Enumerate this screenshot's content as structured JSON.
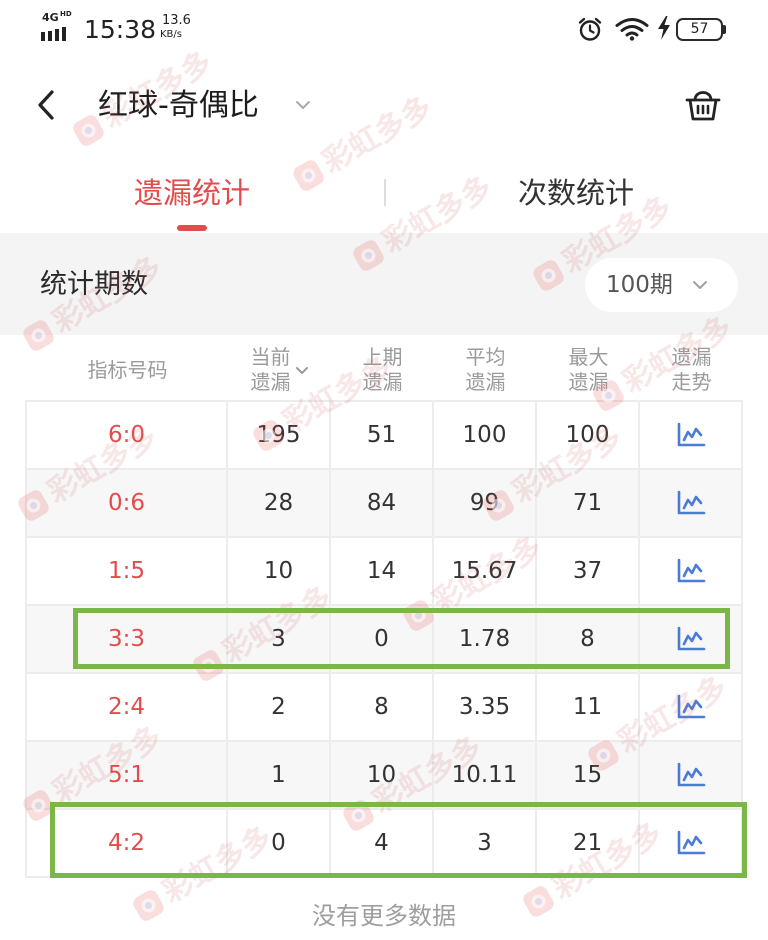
{
  "status_bar": {
    "network": "4G",
    "network_badge": "HD",
    "time": "15:38",
    "speed": "13.6",
    "speed_unit": "KB/s",
    "battery_level": "57",
    "icons": [
      "signal-icon",
      "alarm-icon",
      "wifi-icon",
      "charging-icon",
      "battery-icon"
    ]
  },
  "header": {
    "back_icon": "chevron-left-icon",
    "title": "红球-奇偶比",
    "title_menu_icon": "chevron-down-icon",
    "action_icon": "basket-icon"
  },
  "tabs": [
    {
      "label": "遗漏统计",
      "active": true
    },
    {
      "label": "次数统计",
      "active": false
    }
  ],
  "period_filter": {
    "label": "统计期数",
    "value": "100期",
    "icon": "chevron-down-icon"
  },
  "table": {
    "columns": [
      {
        "lines": [
          "指标号码"
        ]
      },
      {
        "lines": [
          "当前",
          "遗漏"
        ],
        "sort_icon": "chevron-down-icon"
      },
      {
        "lines": [
          "上期",
          "遗漏"
        ]
      },
      {
        "lines": [
          "平均",
          "遗漏"
        ]
      },
      {
        "lines": [
          "最大",
          "遗漏"
        ]
      },
      {
        "lines": [
          "遗漏",
          "走势"
        ]
      }
    ],
    "rows": [
      {
        "label": "6:0",
        "current": "195",
        "previous": "51",
        "average": "100",
        "max": "100",
        "trend_icon": "line-chart-icon",
        "highlighted": false
      },
      {
        "label": "0:6",
        "current": "28",
        "previous": "84",
        "average": "99",
        "max": "71",
        "trend_icon": "line-chart-icon",
        "highlighted": false
      },
      {
        "label": "1:5",
        "current": "10",
        "previous": "14",
        "average": "15.67",
        "max": "37",
        "trend_icon": "line-chart-icon",
        "highlighted": false
      },
      {
        "label": "3:3",
        "current": "3",
        "previous": "0",
        "average": "1.78",
        "max": "8",
        "trend_icon": "line-chart-icon",
        "highlighted": true
      },
      {
        "label": "2:4",
        "current": "2",
        "previous": "8",
        "average": "3.35",
        "max": "11",
        "trend_icon": "line-chart-icon",
        "highlighted": false
      },
      {
        "label": "5:1",
        "current": "1",
        "previous": "10",
        "average": "10.11",
        "max": "15",
        "trend_icon": "line-chart-icon",
        "highlighted": false
      },
      {
        "label": "4:2",
        "current": "0",
        "previous": "4",
        "average": "3",
        "max": "21",
        "trend_icon": "line-chart-icon",
        "highlighted": true
      }
    ]
  },
  "footer_text": "没有更多数据",
  "watermark": {
    "text": "彩虹多多",
    "icon": "brand-logo-icon"
  },
  "colors": {
    "accent": "#e24c4c",
    "highlight_box": "#7ab648",
    "trend_icon": "#4a7bd5",
    "row_alt": "#f7f7f7",
    "band": "#f4f4f4"
  }
}
